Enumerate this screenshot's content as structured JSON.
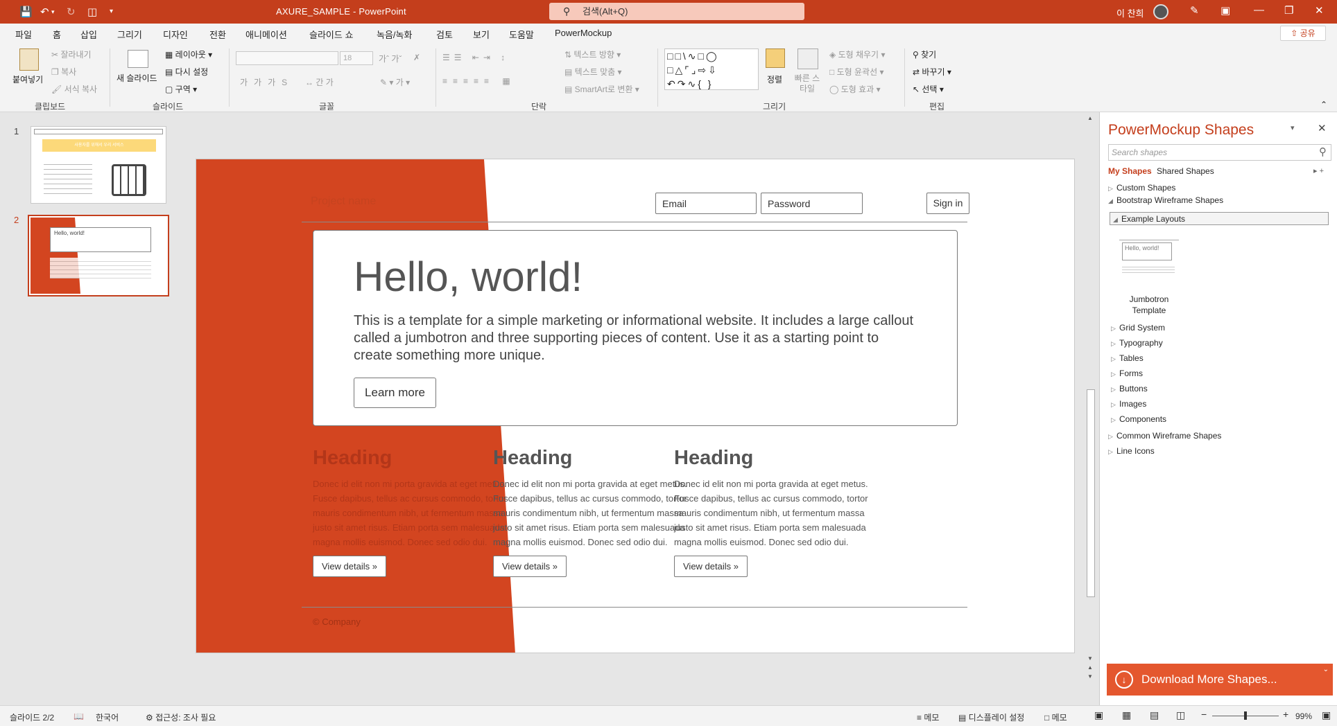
{
  "titlebar": {
    "doc_title": "AXURE_SAMPLE  -  PowerPoint",
    "search_label": "검색(Alt+Q)",
    "user_name": "이 찬희"
  },
  "menu": {
    "tabs": [
      "파일",
      "홈",
      "삽입",
      "그리기",
      "디자인",
      "전환",
      "애니메이션",
      "슬라이드 쇼",
      "녹음/녹화",
      "검토",
      "보기",
      "도움말",
      "PowerMockup"
    ],
    "active_index": 1,
    "share": "공유"
  },
  "ribbon": {
    "clipboard": {
      "paste": "붙여넣기",
      "cut": "잘라내기",
      "copy": "복사",
      "format_painter": "서식 복사",
      "label": "클립보드"
    },
    "slides": {
      "new_slide": "새 슬라이드",
      "layout": "레이아웃",
      "reset": "다시 설정",
      "section": "구역",
      "label": "슬라이드"
    },
    "font": {
      "size": "18",
      "label": "글꼴"
    },
    "paragraph": {
      "text_direction": "텍스트 방향",
      "align_text": "텍스트 맞춤",
      "smartart": "SmartArt로 변환",
      "label": "단락"
    },
    "drawing": {
      "arrange": "정렬",
      "quick_styles": "빠른 스타일",
      "fill": "도형 채우기",
      "outline": "도형 윤곽선",
      "effects": "도형 효과",
      "label": "그리기"
    },
    "editing": {
      "find": "찾기",
      "replace": "바꾸기",
      "select": "선택",
      "label": "편집"
    }
  },
  "thumbnails": {
    "items": [
      {
        "num": "1"
      },
      {
        "num": "2"
      }
    ],
    "thumb1_banner": "사용자를 위해서 우리 서비스",
    "thumb2_title": "Hello, world!"
  },
  "slide": {
    "project_name": "Project name",
    "email_placeholder": "Email",
    "password_placeholder": "Password",
    "sign_in": "Sign in",
    "jumbo_title": "Hello, world!",
    "jumbo_text": "This is a template for a simple marketing or informational website. It includes a large callout called a jumbotron and three supporting pieces of content. Use it as a starting point to create something more unique.",
    "learn_more": "Learn more",
    "columns": [
      {
        "heading": "Heading",
        "text": "Donec id elit non mi porta gravida at eget metus. Fusce dapibus, tellus ac cursus commodo, tortor mauris condimentum nibh, ut fermentum massa justo sit amet risus. Etiam porta sem malesuada magna mollis euismod. Donec sed odio dui.",
        "button": "View details »"
      },
      {
        "heading": "Heading",
        "text": "Donec id elit non mi porta gravida at eget metus. Fusce dapibus, tellus ac cursus commodo, tortor mauris condimentum nibh, ut fermentum massa justo sit amet risus. Etiam porta sem malesuada magna mollis euismod. Donec sed odio dui.",
        "button": "View details »"
      },
      {
        "heading": "Heading",
        "text": "Donec id elit non mi porta gravida at eget metus. Fusce dapibus, tellus ac cursus commodo, tortor mauris condimentum nibh, ut fermentum massa justo sit amet risus. Etiam porta sem malesuada magna mollis euismod. Donec sed odio dui.",
        "button": "View details »"
      }
    ],
    "copyright": "© Company"
  },
  "powermockup": {
    "title": "PowerMockup Shapes",
    "search_placeholder": "Search shapes",
    "tab_my": "My Shapes",
    "tab_shared": "Shared Shapes",
    "tree": {
      "custom": "Custom Shapes",
      "bootstrap": "Bootstrap Wireframe Shapes",
      "example_layouts": "Example Layouts",
      "jumbotron_template_line1": "Jumbotron",
      "jumbotron_template_line2": "Template",
      "thumb_text": "Hello, world!",
      "sub": [
        "Grid System",
        "Typography",
        "Tables",
        "Forms",
        "Buttons",
        "Images",
        "Components"
      ],
      "common": "Common Wireframe Shapes",
      "line_icons": "Line Icons"
    },
    "download": "Download More Shapes..."
  },
  "status": {
    "slide_count": "슬라이드 2/2",
    "language": "한국어",
    "accessibility": "접근성: 조사 필요",
    "notes": "메모",
    "display_settings": "디스플레이 설정",
    "comments": "메모",
    "zoom": "99%"
  },
  "colors": {
    "accent": "#c43e1c",
    "slide_orange": "#d34520"
  }
}
